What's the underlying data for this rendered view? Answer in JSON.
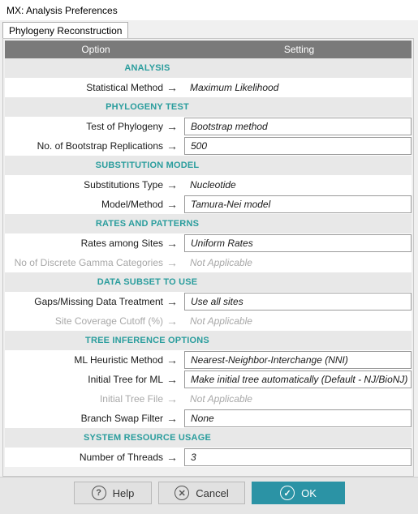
{
  "window": {
    "title": "MX: Analysis Preferences"
  },
  "tabs": [
    {
      "label": "Phylogeny Reconstruction"
    }
  ],
  "grid": {
    "col_option": "Option",
    "col_setting": "Setting",
    "rows": [
      {
        "kind": "section",
        "label": "ANALYSIS"
      },
      {
        "kind": "option",
        "label": "Statistical Method",
        "value": "Maximum Likelihood",
        "boxed": false,
        "disabled": false
      },
      {
        "kind": "section",
        "label": "PHYLOGENY TEST"
      },
      {
        "kind": "option",
        "label": "Test of Phylogeny",
        "value": "Bootstrap method",
        "boxed": true,
        "disabled": false
      },
      {
        "kind": "option",
        "label": "No. of Bootstrap Replications",
        "value": "500",
        "boxed": true,
        "disabled": false
      },
      {
        "kind": "section",
        "label": "SUBSTITUTION MODEL"
      },
      {
        "kind": "option",
        "label": "Substitutions Type",
        "value": "Nucleotide",
        "boxed": false,
        "disabled": false
      },
      {
        "kind": "option",
        "label": "Model/Method",
        "value": "Tamura-Nei model",
        "boxed": true,
        "disabled": false
      },
      {
        "kind": "section",
        "label": "RATES AND PATTERNS"
      },
      {
        "kind": "option",
        "label": "Rates among Sites",
        "value": "Uniform Rates",
        "boxed": true,
        "disabled": false
      },
      {
        "kind": "option",
        "label": "No of Discrete Gamma Categories",
        "value": "Not Applicable",
        "boxed": false,
        "disabled": true
      },
      {
        "kind": "section",
        "label": "DATA SUBSET TO USE"
      },
      {
        "kind": "option",
        "label": "Gaps/Missing Data Treatment",
        "value": "Use all sites",
        "boxed": true,
        "disabled": false
      },
      {
        "kind": "option",
        "label": "Site Coverage Cutoff (%)",
        "value": "Not Applicable",
        "boxed": false,
        "disabled": true
      },
      {
        "kind": "section",
        "label": "TREE INFERENCE OPTIONS"
      },
      {
        "kind": "option",
        "label": "ML Heuristic Method",
        "value": "Nearest-Neighbor-Interchange (NNI)",
        "boxed": true,
        "disabled": false
      },
      {
        "kind": "option",
        "label": "Initial Tree for ML",
        "value": "Make initial tree automatically (Default - NJ/BioNJ)",
        "boxed": true,
        "disabled": false
      },
      {
        "kind": "option",
        "label": "Initial Tree File",
        "value": "Not Applicable",
        "boxed": false,
        "disabled": true
      },
      {
        "kind": "option",
        "label": "Branch Swap Filter",
        "value": "None",
        "boxed": true,
        "disabled": false
      },
      {
        "kind": "section",
        "label": "SYSTEM RESOURCE USAGE"
      },
      {
        "kind": "option",
        "label": "Number of Threads",
        "value": "3",
        "boxed": true,
        "disabled": false
      }
    ]
  },
  "footer": {
    "help_label": "Help",
    "cancel_label": "Cancel",
    "ok_label": "OK",
    "accent_color": "#2b93a5",
    "section_color": "#2a9d9d"
  }
}
